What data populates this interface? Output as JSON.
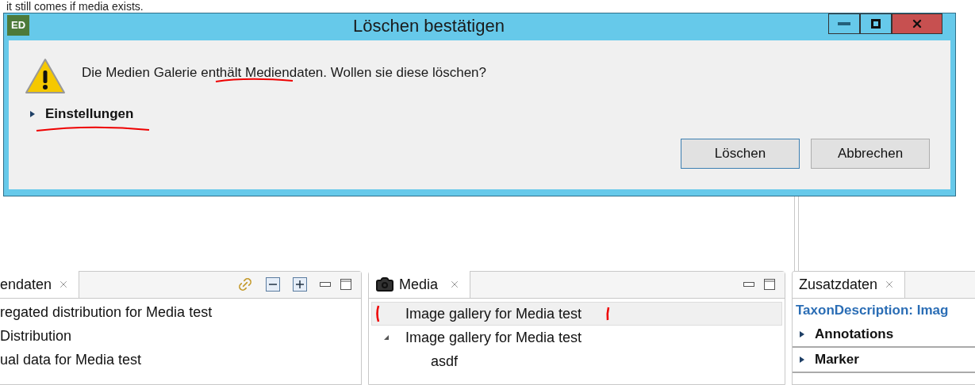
{
  "note": "it still comes if media exists.",
  "dialog": {
    "app_icon": "ED",
    "title": "Löschen bestätigen",
    "message": "Die Medien Galerie enthält Mediendaten. Wollen sie diese löschen?",
    "details": {
      "label": "Einstellungen",
      "expanded": false
    },
    "buttons": [
      {
        "label": "Löschen",
        "default": true
      },
      {
        "label": "Abbrechen",
        "default": false
      }
    ]
  },
  "left_panel": {
    "tab": "endaten",
    "rows": [
      "regated distribution for Media test",
      "Distribution",
      "ual data for Media test"
    ]
  },
  "media_panel": {
    "tab": "Media",
    "tree": [
      {
        "label": "Image gallery for Media test",
        "selected": true
      },
      {
        "label": "Image gallery for Media test",
        "selected": false,
        "expanded": true,
        "children": [
          {
            "label": "asdf",
            "selected": false
          }
        ]
      }
    ]
  },
  "details_panel": {
    "tab": "Zusatzdaten",
    "heading": "TaxonDescription: Imag",
    "sections": [
      {
        "label": "Annotations",
        "expanded": false
      },
      {
        "label": "Marker",
        "expanded": false
      }
    ]
  }
}
